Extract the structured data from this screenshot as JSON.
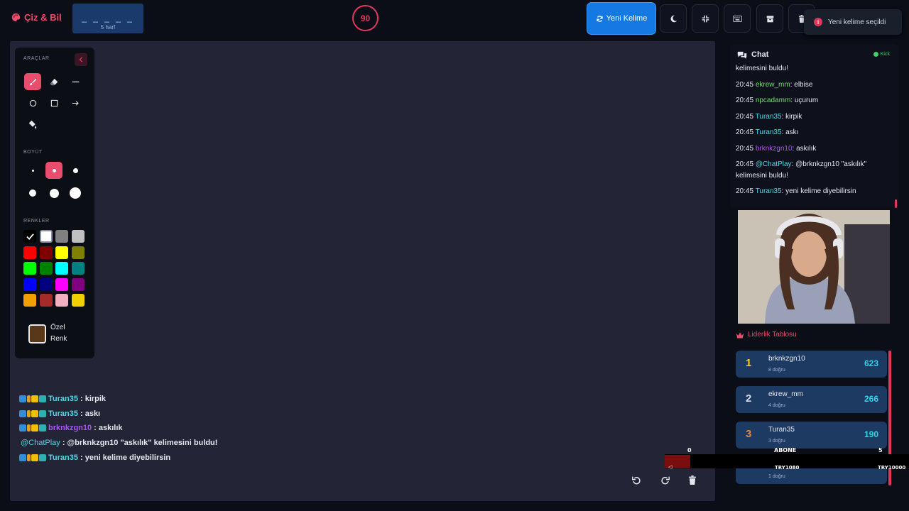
{
  "header": {
    "brand": "Çiz & Bil",
    "word_mask": "_ _ _ _ _",
    "word_length": "5 harf",
    "timer": "90",
    "new_word_label": "Yeni Kelime",
    "toast": "Yeni kelime seçildi"
  },
  "tools_panel": {
    "tools_title": "ARAÇLAR",
    "size_title": "BOYUT",
    "colors_title": "RENKLER",
    "custom_color_line1": "Özel",
    "custom_color_line2": "Renk",
    "active_tool": "brush",
    "active_size": 2,
    "custom_color": "#5a3716",
    "colors": [
      "#000000",
      "#ffffff",
      "#808080",
      "#c0c0c0",
      "#ff0000",
      "#800000",
      "#ffff00",
      "#808000",
      "#00ff00",
      "#008000",
      "#00ffff",
      "#008080",
      "#0000ff",
      "#000080",
      "#ff00ff",
      "#800080",
      "#f0a000",
      "#a52a2a",
      "#f0b0c0",
      "#f0d000"
    ]
  },
  "canvas_chat": [
    {
      "user": "Turan35",
      "user_color": "#4fd8e8",
      "message": ": kirpik",
      "badges": true
    },
    {
      "user": "Turan35",
      "user_color": "#4fd8e8",
      "message": ": askı",
      "badges": true
    },
    {
      "user": "brknkzgn10",
      "user_color": "#a855f7",
      "message": ": askılık",
      "badges": true
    },
    {
      "user": "@ChatPlay",
      "user_color": "#4fd8e8",
      "message": ": @brknkzgn10 \"askılık\" kelimesini buldu!",
      "badges": false
    },
    {
      "user": "Turan35",
      "user_color": "#4fd8e8",
      "message": ": yeni kelime diyebilirsin",
      "badges": true
    }
  ],
  "chat": {
    "title": "Chat",
    "status": "Kick",
    "messages": [
      {
        "time": "",
        "user": "",
        "user_color": "#e6e8f0",
        "text": "kelimesini buldu!"
      },
      {
        "time": "20:45",
        "user": "ekrew_mm",
        "user_color": "#6ee06e",
        "text": ": elbise"
      },
      {
        "time": "20:45",
        "user": "npcadamm",
        "user_color": "#6ee06e",
        "text": ": uçurum"
      },
      {
        "time": "20:45",
        "user": "Turan35",
        "user_color": "#4fd8e8",
        "text": ": kirpik"
      },
      {
        "time": "20:45",
        "user": "Turan35",
        "user_color": "#4fd8e8",
        "text": ": askı"
      },
      {
        "time": "20:45",
        "user": "brknkzgn10",
        "user_color": "#a855f7",
        "text": ": askılık"
      },
      {
        "time": "20:45",
        "user": "@ChatPlay",
        "user_color": "#4fd8e8",
        "text": ": @brknkzgn10 \"askılık\" kelimesini buldu!"
      },
      {
        "time": "20:45",
        "user": "Turan35",
        "user_color": "#4fd8e8",
        "text": ": yeni kelime diyebilirsin"
      }
    ]
  },
  "leaderboard": {
    "title": "Liderlik Tablosu",
    "rows": [
      {
        "rank": "1",
        "rank_color": "#f5d020",
        "name": "brknkzgn10",
        "sub": "8 doğru",
        "score": "623"
      },
      {
        "rank": "2",
        "rank_color": "#d8dce6",
        "name": "ekrew_mm",
        "sub": "4 doğru",
        "score": "266"
      },
      {
        "rank": "3",
        "rank_color": "#e0873a",
        "name": "Turan35",
        "sub": "3 doğru",
        "score": "190"
      },
      {
        "rank": "",
        "rank_color": "#d8dce6",
        "name": "",
        "sub": "1 doğru",
        "score": ""
      }
    ]
  },
  "goal": {
    "current": "0",
    "label": "ABONE",
    "target": "5",
    "left_text": "TRY1080",
    "right_text": "TRY10000"
  }
}
